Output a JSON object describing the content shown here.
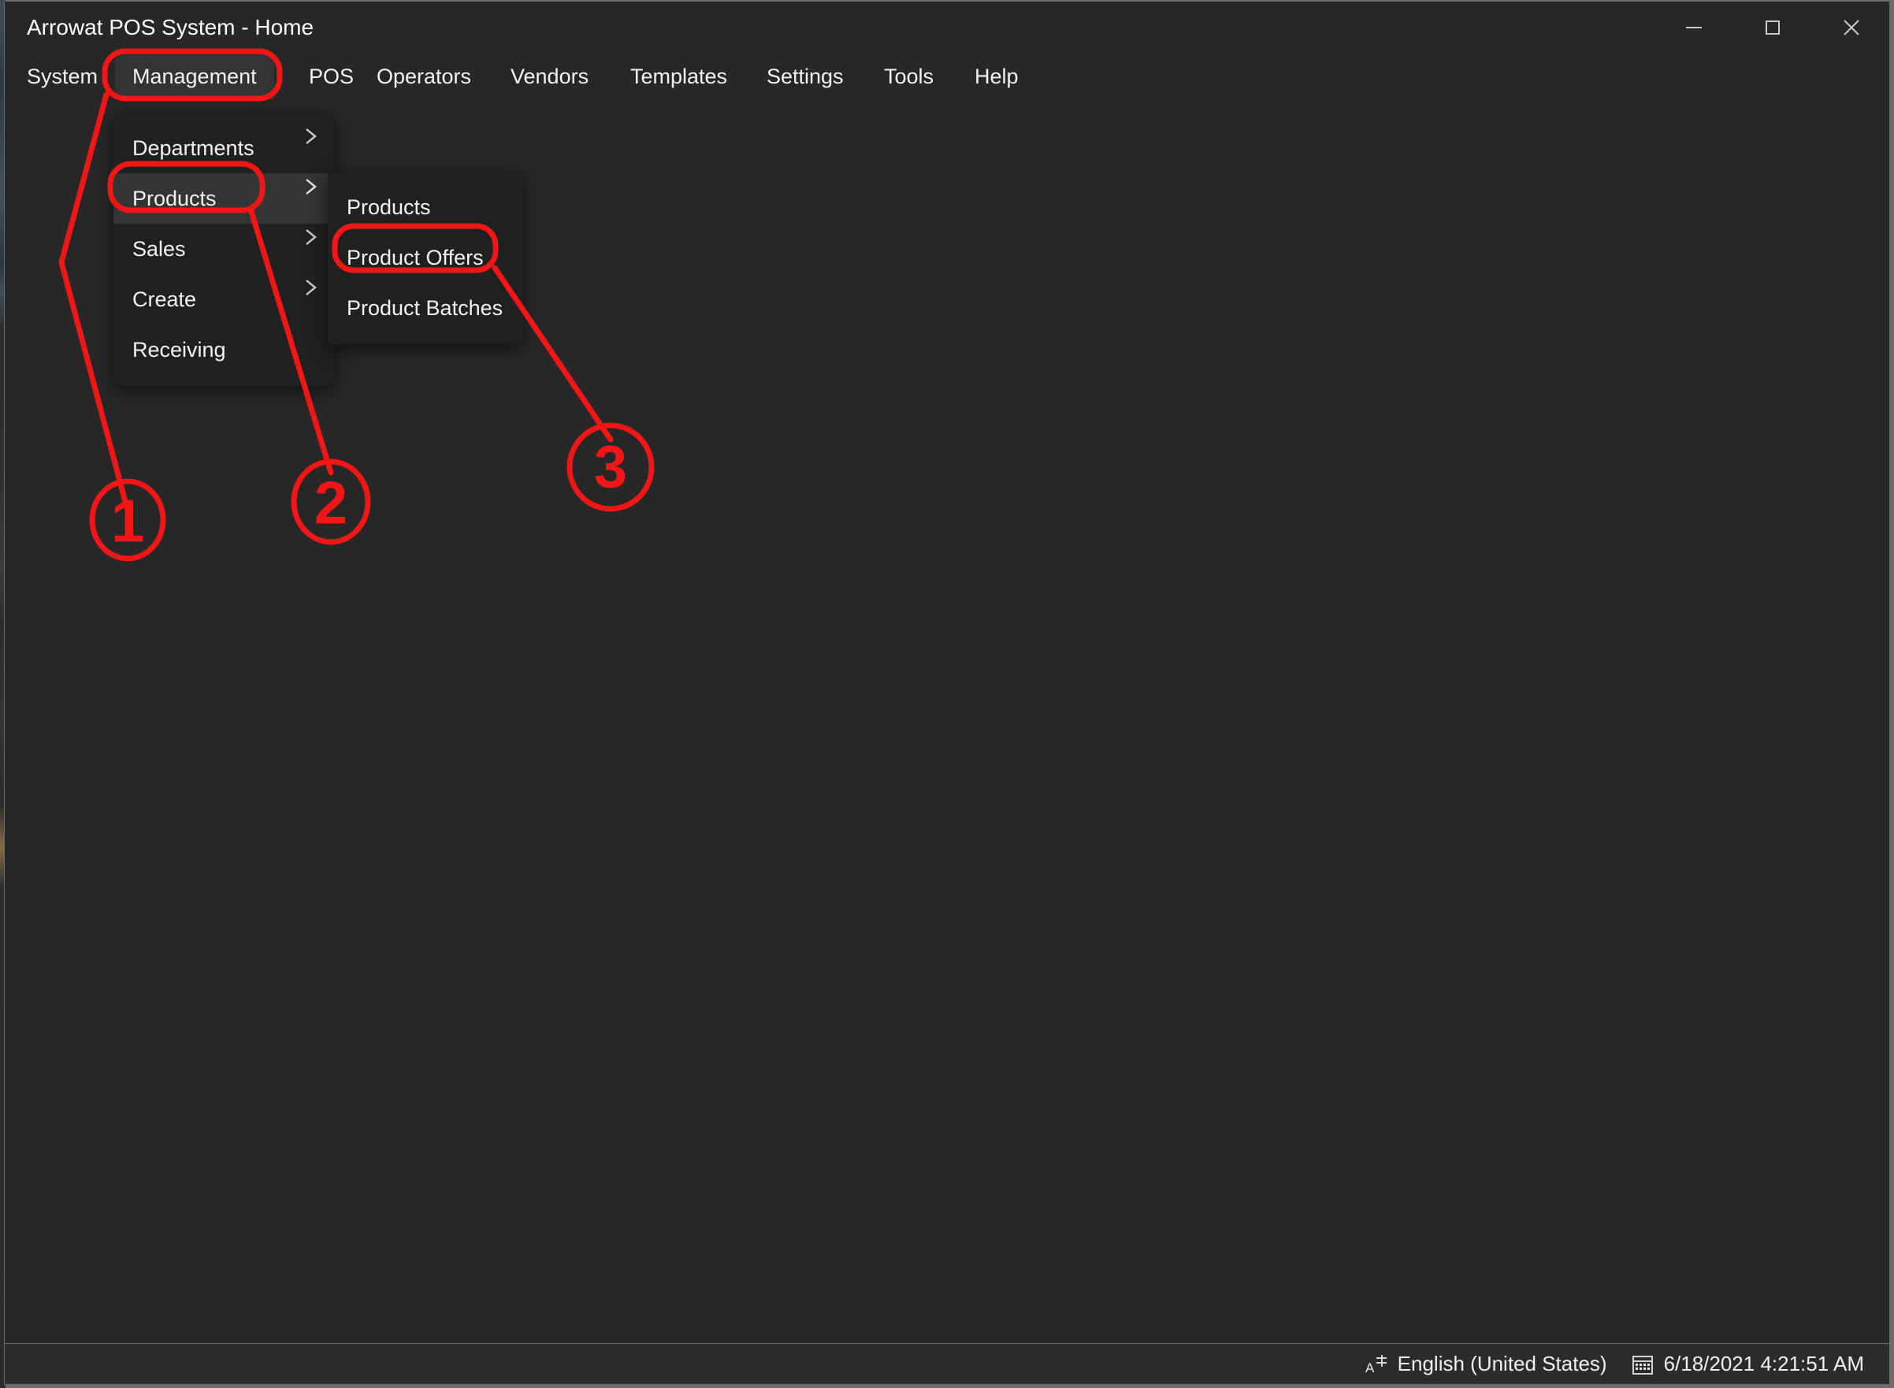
{
  "window": {
    "title": "Arrowat POS System - Home",
    "background_color": "#272727",
    "controls": [
      {
        "name": "minimize",
        "glyph": "minimize-icon"
      },
      {
        "name": "maximize",
        "glyph": "maximize-icon"
      },
      {
        "name": "close",
        "glyph": "close-icon"
      }
    ]
  },
  "menubar": {
    "items": [
      {
        "label": "System",
        "open": false
      },
      {
        "label": "Management",
        "open": true
      },
      {
        "label": "POS",
        "open": false
      },
      {
        "label": "Operators",
        "open": false
      },
      {
        "label": "Vendors",
        "open": false
      },
      {
        "label": "Templates",
        "open": false
      },
      {
        "label": "Settings",
        "open": false
      },
      {
        "label": "Tools",
        "open": false
      },
      {
        "label": "Help",
        "open": false
      }
    ]
  },
  "management_menu": {
    "items": [
      {
        "label": "Departments",
        "has_submenu": true,
        "selected": false
      },
      {
        "label": "Products",
        "has_submenu": true,
        "selected": true
      },
      {
        "label": "Sales",
        "has_submenu": true,
        "selected": false
      },
      {
        "label": "Create",
        "has_submenu": true,
        "selected": false
      },
      {
        "label": "Receiving",
        "has_submenu": false,
        "selected": false
      }
    ]
  },
  "products_submenu": {
    "items": [
      {
        "label": "Products",
        "selected": false
      },
      {
        "label": "Product Offers",
        "selected": false
      },
      {
        "label": "Product Batches",
        "selected": false
      }
    ]
  },
  "statusbar": {
    "language": "English (United States)",
    "language_icon": "input-language-icon",
    "datetime": "6/18/2021 4:21:51 AM",
    "datetime_icon": "calendar-icon"
  },
  "annotations": {
    "accent_color": "#f01616",
    "steps": [
      {
        "number": "1",
        "target": "Management menu"
      },
      {
        "number": "2",
        "target": "Products submenu item"
      },
      {
        "number": "3",
        "target": "Product Offers menu item"
      }
    ]
  }
}
